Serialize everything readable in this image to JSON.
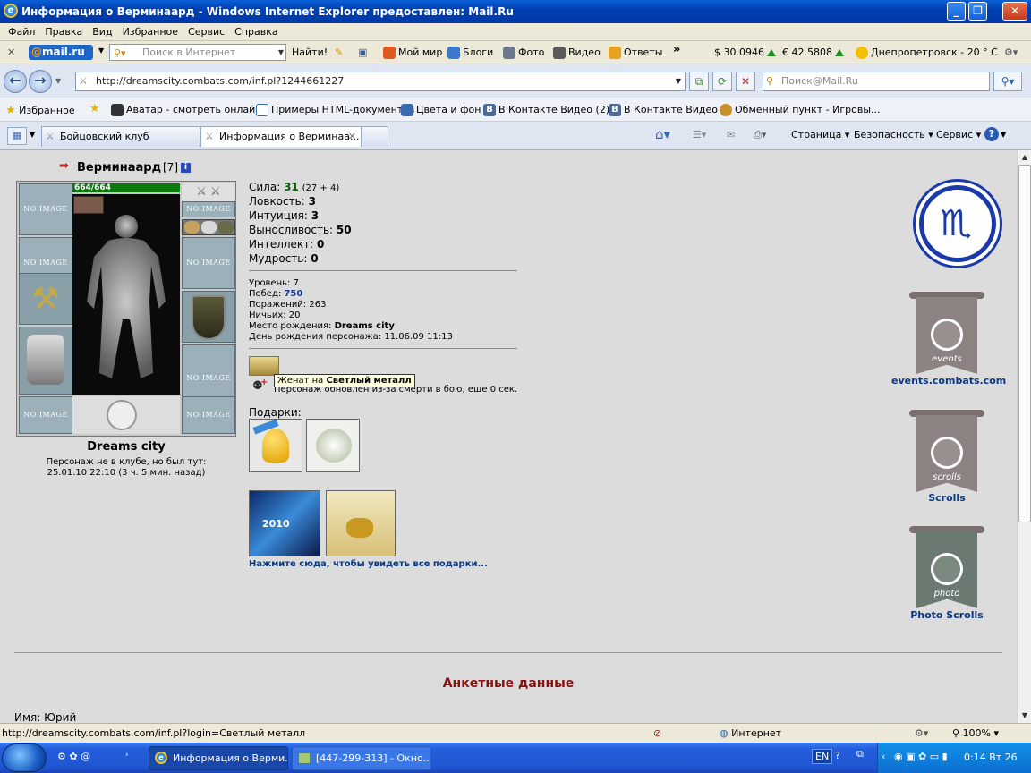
{
  "window": {
    "title": "Информация о Верминаард - Windows Internet Explorer предоставлен: Mail.Ru"
  },
  "menu": [
    "Файл",
    "Правка",
    "Вид",
    "Избранное",
    "Сервис",
    "Справка"
  ],
  "mailbar": {
    "logo_at": "@",
    "logo_mail": "mail",
    "logo_ru": ".ru",
    "search_placeholder": "Поиск в Интернет",
    "find": "Найти!",
    "items": [
      "Мой мир",
      "Блоги",
      "Фото",
      "Видео",
      "Ответы"
    ],
    "more": "»",
    "usd": "$ 30.0946",
    "eur": "€ 42.5808",
    "weather": "Днепропетровск  - 20 ° C"
  },
  "address": {
    "url": "http://dreamscity.combats.com/inf.pl?1244661227",
    "search_placeholder": "Поиск@Mail.Ru"
  },
  "favorites": {
    "label": "Избранное",
    "items": [
      "Аватар - смотреть онлайн",
      "Примеры HTML-документов",
      "Цвета и фон",
      "В Контакте  Видео (2)",
      "В Контакте  Видео",
      "Обменный пункт - Игровы..."
    ]
  },
  "tabs": [
    "Бойцовский клуб",
    "Информация о Верминаа..."
  ],
  "commands": [
    "Страница",
    "Безопасность",
    "Сервис"
  ],
  "character": {
    "name": "Верминаард",
    "level_tag": "[7]",
    "hp": "664/664",
    "no_image": "NO IMAGE",
    "city": "Dreams city",
    "offline_text": "Персонаж не в клубе, но был тут:",
    "last_seen": "25.01.10 22:10 (3 ч. 5 мин. назад)"
  },
  "stats": [
    {
      "label": "Сила:",
      "value": "31",
      "extra": "(27 + 4)"
    },
    {
      "label": "Ловкость:",
      "value": "3",
      "extra": ""
    },
    {
      "label": "Интуиция:",
      "value": "3",
      "extra": ""
    },
    {
      "label": "Выносливость:",
      "value": "50",
      "extra": ""
    },
    {
      "label": "Интеллект:",
      "value": "0",
      "extra": ""
    },
    {
      "label": "Мудрость:",
      "value": "0",
      "extra": ""
    }
  ],
  "info": {
    "level": "Уровень: 7",
    "wins_label": "Побед:",
    "wins": "750",
    "losses": "Поражений: 263",
    "draws": "Ничьих: 20",
    "birthplace_label": "Место рождения:",
    "birthplace": "Dreams city",
    "birthday": "День рождения персонажа: 11.06.09 11:13"
  },
  "married": {
    "prefix": "Женат на",
    "name": "Светлый металл"
  },
  "resurrect": "Персонаж обновлен из-за смерти в бою, еще 0 сек.",
  "gifts": {
    "label": "Подарки:",
    "link": "Нажмите сюда, чтобы увидеть все подарки..."
  },
  "sidebar": {
    "events_word": "events",
    "events": "events.combats.com",
    "scrolls_word": "scrolls",
    "scrolls": "Scrolls",
    "photo_word": "photo",
    "photo": "Photo Scrolls"
  },
  "profile": {
    "heading": "Анкетные данные",
    "name_row": "Имя: Юрий"
  },
  "status": {
    "url": "http://dreamscity.combats.com/inf.pl?login=Светлый металл",
    "zone": "Интернет",
    "zoom": "100%"
  },
  "taskbar": {
    "buttons": [
      "Информация о Верми...",
      "[447-299-313] - Окно..."
    ],
    "lang": "EN",
    "clock": "0:14 Вт 26"
  }
}
